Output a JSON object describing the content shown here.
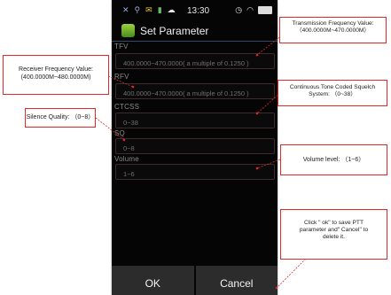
{
  "status_bar": {
    "time": "13:30"
  },
  "header": {
    "title": "Set Parameter"
  },
  "fields": [
    {
      "label": "TFV",
      "placeholder": "400.0000~470.0000( a multiple of 0.1250 )"
    },
    {
      "label": "RFV",
      "placeholder": "400.0000~470.0000( a multiple of 0.1250 )"
    },
    {
      "label": "CTCSS",
      "placeholder": "0~38"
    },
    {
      "label": "SQ",
      "placeholder": "0~8"
    },
    {
      "label": "Volume",
      "placeholder": "1~6"
    }
  ],
  "buttons": {
    "ok": "OK",
    "cancel": "Cancel"
  },
  "annotations": {
    "tfv": "Transmission Frequency Value:\n（400.0000M~470.0000M）",
    "rfv": "Receiver Frequency Value:\n(400.0000M~480.0000M)",
    "ctcss": "Continuous Tone Coded Squelch\nSystem: （0~38）",
    "sq": "Silence Quality: （0~8）",
    "volume": "Volume level: （1~6）",
    "buttons": "Click \" ok\" to save PTT\nparameter and\" Cancel\" to\ndelete it."
  },
  "colors": {
    "callout_border": "#e02a2a",
    "screen_bg": "#050505",
    "button_bg": "#2c2c2c"
  }
}
